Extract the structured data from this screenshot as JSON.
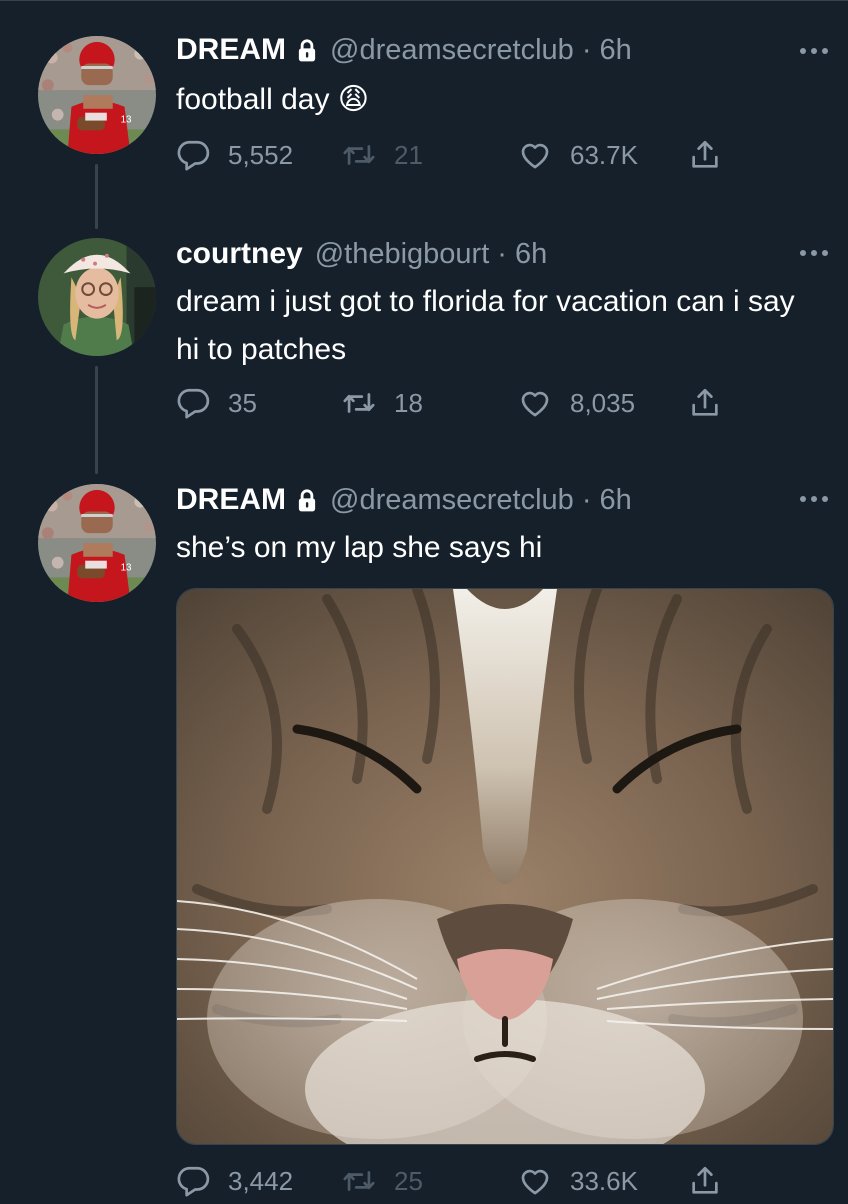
{
  "tweets": [
    {
      "name": "DREAM",
      "handle": "@dreamsecretclub",
      "separator": "·",
      "time": "6h",
      "text": "football day 😩",
      "replies": "5,552",
      "retweets": "21",
      "likes": "63.7K",
      "avatar": "football-player-avatar"
    },
    {
      "name": "courtney",
      "handle": "@thebigbourt",
      "separator": "·",
      "time": "6h",
      "text": "dream i just got to florida for vacation can i say hi to patches",
      "replies": "35",
      "retweets": "18",
      "likes": "8,035",
      "avatar": "woman-bucket-hat-avatar"
    },
    {
      "name": "DREAM",
      "handle": "@dreamsecretclub",
      "separator": "·",
      "time": "6h",
      "text": "she’s on my lap she says hi",
      "replies": "3,442",
      "retweets": "25",
      "likes": "33.6K",
      "media": "cat-photo",
      "avatar": "football-player-avatar"
    }
  ],
  "icons": {
    "reply": "reply-icon",
    "retweet": "retweet-icon",
    "like": "heart-icon",
    "share": "share-icon",
    "locked": "lock-icon",
    "more": "more-icon"
  },
  "colors": {
    "background": "#15202b",
    "secondary_text": "#8b98a5",
    "divider": "#38444d"
  }
}
